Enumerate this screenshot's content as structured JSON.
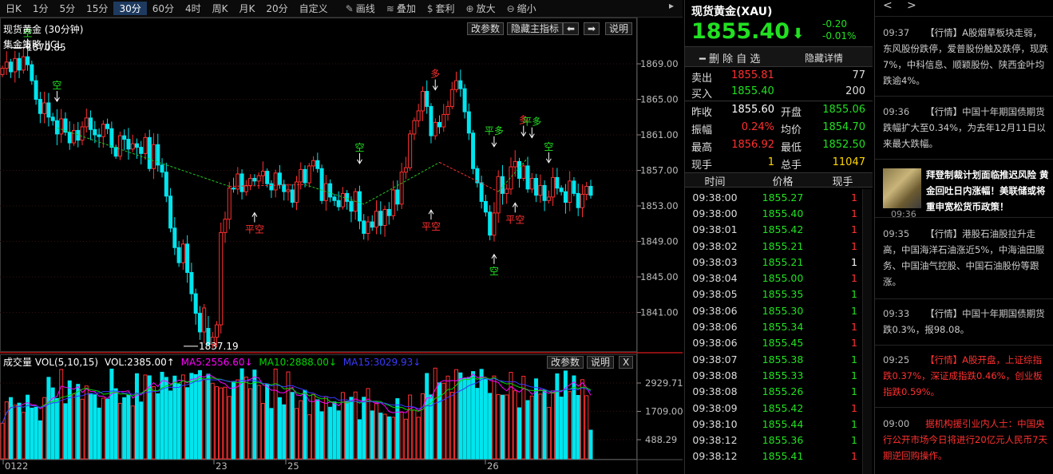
{
  "toolbar": {
    "periods": [
      "日K",
      "1分",
      "5分",
      "15分",
      "30分",
      "60分",
      "4时",
      "周K",
      "月K",
      "20分",
      "自定义"
    ],
    "active": "30分",
    "tools": [
      {
        "icon": "pencil-icon",
        "glyph": "✎",
        "label": "画线"
      },
      {
        "icon": "stack-icon",
        "glyph": "≋",
        "label": "叠加"
      },
      {
        "icon": "moneybag-icon",
        "glyph": "$",
        "label": "套利"
      },
      {
        "icon": "zoom-in-icon",
        "glyph": "⊕",
        "label": "放大"
      },
      {
        "icon": "zoom-out-icon",
        "glyph": "⊖",
        "label": "缩小"
      }
    ],
    "more_glyph": "▸"
  },
  "main_chart": {
    "title": "现货黄金 (30分钟)",
    "strategy": "集金策略 JJCL",
    "buttons": {
      "params": "改参数",
      "hide": "隐藏主指标",
      "left": "⬅",
      "right": "➡",
      "help": "说明"
    },
    "y_labels": [
      "1869.00",
      "1865.00",
      "1861.00",
      "1857.00",
      "1853.00",
      "1849.00",
      "1845.00",
      "1841.00"
    ],
    "high_label": "1870.85",
    "low_label": "1837.19",
    "signals": {
      "short": "空",
      "long": "多",
      "close_long": "平多",
      "close_short": "平空"
    }
  },
  "volume": {
    "title": "成交量 VOL(5,10,15)",
    "vol": "VOL:2385.00↑",
    "ma5": "MA5:2556.60↓",
    "ma10": "MA10:2888.00↓",
    "ma15": "MA15:3029.93↓",
    "buttons": {
      "params": "改参数",
      "help": "说明",
      "close": "X"
    },
    "y_labels": [
      "2929.71",
      "1709.00",
      "488.29"
    ]
  },
  "x_labels": [
    "0122",
    "23",
    "25",
    "26"
  ],
  "colors": {
    "up": "#ff3030",
    "down": "#00e5ee",
    "ma_green": "#22c822",
    "ma_red": "#ff3030",
    "ma5": "#ff00ff",
    "ma10": "#00d800",
    "ma15": "#2020ff"
  },
  "quote": {
    "name": "现货黄金(XAU)",
    "price": "1855.40",
    "arrow": "⬇",
    "change": "-0.20",
    "change_pct": "-0.01%",
    "actions": {
      "self_select": "━ 删 除 自 选",
      "hide_detail": "隐藏详情"
    },
    "sell": {
      "label": "卖出",
      "price": "1855.81",
      "vol": "77"
    },
    "buy": {
      "label": "买入",
      "price": "1855.40",
      "vol": "200"
    },
    "stats": [
      {
        "l1": "昨收",
        "v1": "1855.60",
        "c1": "#fff",
        "l2": "开盘",
        "v2": "1855.06",
        "c2": "#22e022"
      },
      {
        "l1": "振幅",
        "v1": "0.24%",
        "c1": "#ff3030",
        "l2": "均价",
        "v2": "1854.70",
        "c2": "#22e022"
      },
      {
        "l1": "最高",
        "v1": "1856.92",
        "c1": "#ff3030",
        "l2": "最低",
        "v2": "1852.50",
        "c2": "#22e022"
      },
      {
        "l1": "现手",
        "v1": "1",
        "c1": "#ffd700",
        "l2": "总手",
        "v2": "11047",
        "c2": "#ffd700"
      }
    ]
  },
  "ticks": {
    "headers": [
      "时间",
      "价格",
      "现手"
    ],
    "rows": [
      [
        "09:38:00",
        "1855.27",
        "1"
      ],
      [
        "09:38:00",
        "1855.40",
        "1"
      ],
      [
        "09:38:01",
        "1855.42",
        "1"
      ],
      [
        "09:38:02",
        "1855.21",
        "1"
      ],
      [
        "09:38:03",
        "1855.21",
        "1"
      ],
      [
        "09:38:04",
        "1855.00",
        "1"
      ],
      [
        "09:38:05",
        "1855.35",
        "1"
      ],
      [
        "09:38:06",
        "1855.30",
        "1"
      ],
      [
        "09:38:06",
        "1855.34",
        "1"
      ],
      [
        "09:38:06",
        "1855.45",
        "1"
      ],
      [
        "09:38:07",
        "1855.38",
        "1"
      ],
      [
        "09:38:08",
        "1855.33",
        "1"
      ],
      [
        "09:38:08",
        "1855.26",
        "1"
      ],
      [
        "09:38:09",
        "1855.42",
        "1"
      ],
      [
        "09:38:10",
        "1855.44",
        "1"
      ],
      [
        "09:38:12",
        "1855.36",
        "1"
      ],
      [
        "09:38:12",
        "1855.41",
        "1"
      ]
    ],
    "vol_colors": [
      "#ff3030",
      "#ff3030",
      "#ff3030",
      "#ff3030",
      "#fff",
      "#ff3030",
      "#22e022",
      "#22e022",
      "#ff3030",
      "#ff3030",
      "#22e022",
      "#22e022",
      "#22e022",
      "#ff3030",
      "#22e022",
      "#22e022",
      "#ff3030"
    ]
  },
  "news": {
    "nav": [
      "<",
      ">"
    ],
    "items": [
      {
        "time": "09:37",
        "text": "【行情】A股烟草板块走弱，东风股份跌停，爱普股份触及跌停，现跌7%，中科信息、顺颖股份、陕西金叶均跌逾4%。",
        "color": "#ccc"
      },
      {
        "time": "09:36",
        "text": "【行情】中国十年期国债期货跌幅扩大至0.34%，为去年12月11日以来最大跌幅。",
        "color": "#ccc"
      },
      {
        "time": "09:36",
        "text": "拜登制裁计划面临推迟风险 黄金回吐日内涨幅！美联储或将重申宽松货币政策！",
        "color": "#fff",
        "image": "news-photo"
      },
      {
        "time": "09:35",
        "text": "【行情】港股石油股拉升走高，中国海洋石油涨近5%，中海油田服务、中国油气控股、中国石油股份等跟涨。",
        "color": "#ccc"
      },
      {
        "time": "09:33",
        "text": "【行情】中国十年期国债期货跌0.3%，报98.08。",
        "color": "#ccc"
      },
      {
        "time": "09:25",
        "text": "【行情】A股开盘，上证综指跌0.37%，深证成指跌0.46%，创业板指跌0.59%。",
        "color": "#ff3030"
      },
      {
        "time": "09:00",
        "text": "据机构援引业内人士：中国央行公开市场今日将进行20亿元人民币7天期逆回购操作。",
        "color": "#ff3030"
      }
    ]
  }
}
